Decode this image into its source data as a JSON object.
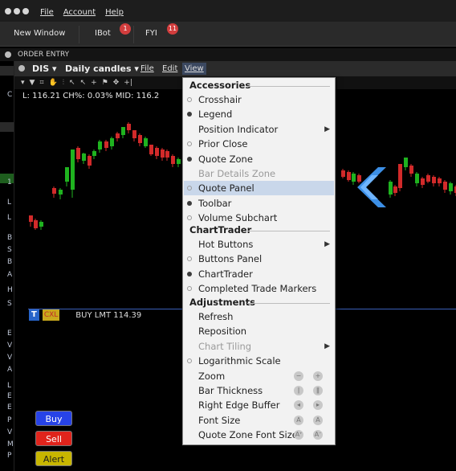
{
  "menubar": {
    "file": "File",
    "account": "Account",
    "help": "Help"
  },
  "toolbar": {
    "new_window": "New Window",
    "ibot": "IBot",
    "ibot_badge": "1",
    "fyi": "FYI",
    "fyi_badge": "11"
  },
  "order_entry": {
    "title": "ORDER ENTRY"
  },
  "chart": {
    "symbol": "DIS ▾",
    "timeframe": "Daily candles ▾",
    "menu_file": "File",
    "menu_edit": "Edit",
    "menu_view": "View",
    "info": "L: 116.21 CH%: 0.03% MID: 116.2",
    "tools": [
      "▾",
      "▼",
      "⌗",
      "✋",
      "⫶",
      "↖",
      "↖",
      "+",
      "⚑",
      "✥",
      "+|"
    ],
    "left_letters": [
      "C",
      "1",
      "L",
      "L",
      "B",
      "S",
      "B",
      "A",
      "H",
      "S",
      "E",
      "V",
      "V",
      "A",
      "L",
      "E",
      "E",
      "P",
      "V",
      "M",
      "P"
    ],
    "order_t": "T",
    "order_cxl": "CXL",
    "order_text": "BUY LMT 114.39",
    "buy": "Buy",
    "sell": "Sell",
    "alert": "Alert",
    "colors": {
      "up": "#1fb31f",
      "down": "#d22a2a",
      "order_line": "#3a5fb8",
      "arrow": "#3c8fe6"
    }
  },
  "dropdown": {
    "accessories": {
      "header": "Accessories",
      "items": [
        {
          "label": "Crosshair",
          "mark": "off"
        },
        {
          "label": "Legend",
          "mark": "on"
        },
        {
          "label": "Position Indicator",
          "mark": "none",
          "submenu": "▶"
        },
        {
          "label": "Prior Close",
          "mark": "off"
        },
        {
          "label": "Quote Zone",
          "mark": "on"
        },
        {
          "label": "Bar Details Zone",
          "mark": "none",
          "disabled": true
        },
        {
          "label": "Quote Panel",
          "mark": "off",
          "highlight": true
        },
        {
          "label": "Toolbar",
          "mark": "on"
        },
        {
          "label": "Volume Subchart",
          "mark": "off"
        }
      ]
    },
    "chart_trader": {
      "header": "ChartTrader",
      "items": [
        {
          "label": "Hot Buttons",
          "mark": "none",
          "submenu": "▶"
        },
        {
          "label": "Buttons Panel",
          "mark": "off"
        },
        {
          "label": "ChartTrader",
          "mark": "on"
        },
        {
          "label": "Completed Trade Markers",
          "mark": "off"
        }
      ]
    },
    "adjustments": {
      "header": "Adjustments",
      "items": [
        {
          "label": "Refresh"
        },
        {
          "label": "Reposition"
        },
        {
          "label": "Chart Tiling",
          "disabled": true,
          "submenu": "▶"
        },
        {
          "label": "Logarithmic Scale",
          "mark": "off"
        },
        {
          "label": "Zoom",
          "icon1": "−",
          "icon2": "+"
        },
        {
          "label": "Bar Thickness",
          "icon1": "ǀ",
          "icon2": "ǁ"
        },
        {
          "label": "Right Edge Buffer",
          "icon1": "◂",
          "icon2": "▸"
        },
        {
          "label": "Font Size",
          "icon1": "A",
          "icon2": "A"
        },
        {
          "label": "Quote Zone Font Size",
          "icon1": "Aᐩ",
          "icon2": "Aᐨ"
        }
      ]
    }
  }
}
